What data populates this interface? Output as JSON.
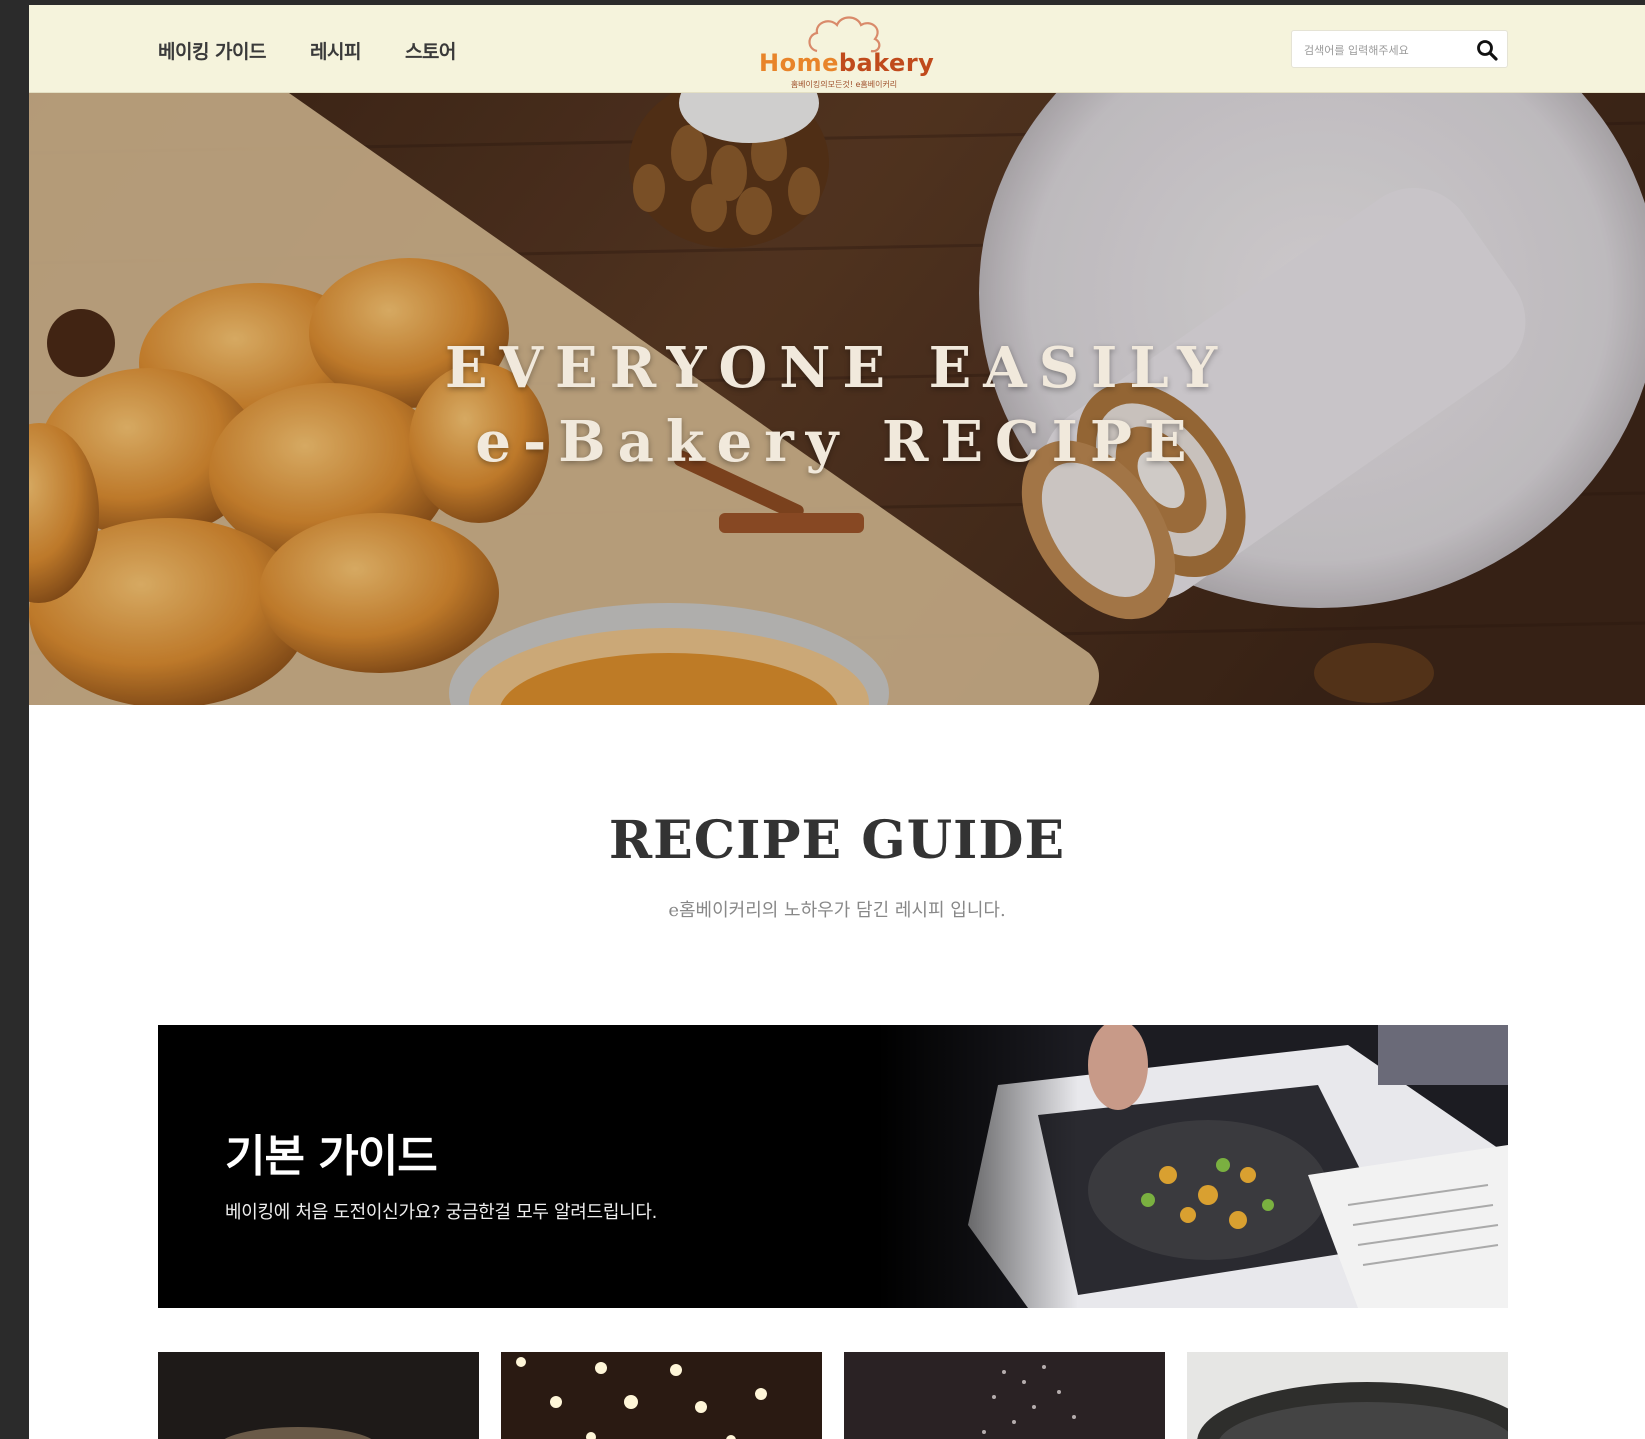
{
  "nav": {
    "items": [
      {
        "label": "베이킹 가이드"
      },
      {
        "label": "레시피"
      },
      {
        "label": "스토어"
      }
    ]
  },
  "logo": {
    "text_a": "Home",
    "text_b": "bakery",
    "tagline": "홈베이킹의모든것! e홈베이커리"
  },
  "search": {
    "placeholder": "검색어를 입력해주세요",
    "icon": "search-icon"
  },
  "hero": {
    "line1": "EVERYONE EASILY",
    "line2": "e-Bakery RECIPE"
  },
  "section": {
    "title": "RECIPE GUIDE",
    "subtitle": "e홈베이커리의 노하우가 담긴 레시피 입니다."
  },
  "guide": {
    "title": "기본 가이드",
    "description": "베이킹에 처음 도전이신가요? 궁금한걸 모두 알려드립니다."
  },
  "colors": {
    "header_bg": "#f5f3dc",
    "logo_orange": "#e8842a",
    "logo_brown": "#c04a1c",
    "heading_text": "#333333"
  }
}
